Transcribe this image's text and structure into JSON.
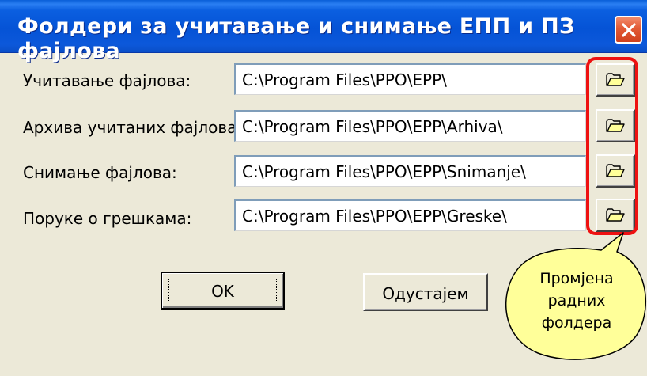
{
  "window": {
    "title": "Фолдери за учитавање и снимање ЕПП и ПЗ фајлова",
    "close_icon": "close-icon"
  },
  "rows": [
    {
      "label": "Учитавање фајлова:",
      "path": "C:\\Program Files\\PPO\\EPP\\",
      "button_icon": "folder-open-icon"
    },
    {
      "label": "Архива учитаних фајлова:",
      "path": "C:\\Program Files\\PPO\\EPP\\Arhiva\\",
      "button_icon": "folder-open-icon"
    },
    {
      "label": "Снимање фајлова:",
      "path": "C:\\Program Files\\PPO\\EPP\\Snimanje\\",
      "button_icon": "folder-open-icon"
    },
    {
      "label": "Поруке о грешкама:",
      "path": "C:\\Program Files\\PPO\\EPP\\Greske\\",
      "button_icon": "folder-open-icon"
    }
  ],
  "buttons": {
    "ok_label": "OK",
    "cancel_label": "Одустајем"
  },
  "callout": {
    "line1": "Промјена",
    "line2": "радних",
    "line3": "фолдера"
  },
  "colors": {
    "titlebar": "#0553d6",
    "highlight": "#ee1111",
    "callout_fill": "#ffff99",
    "dialog_bg": "#ece9d8"
  }
}
